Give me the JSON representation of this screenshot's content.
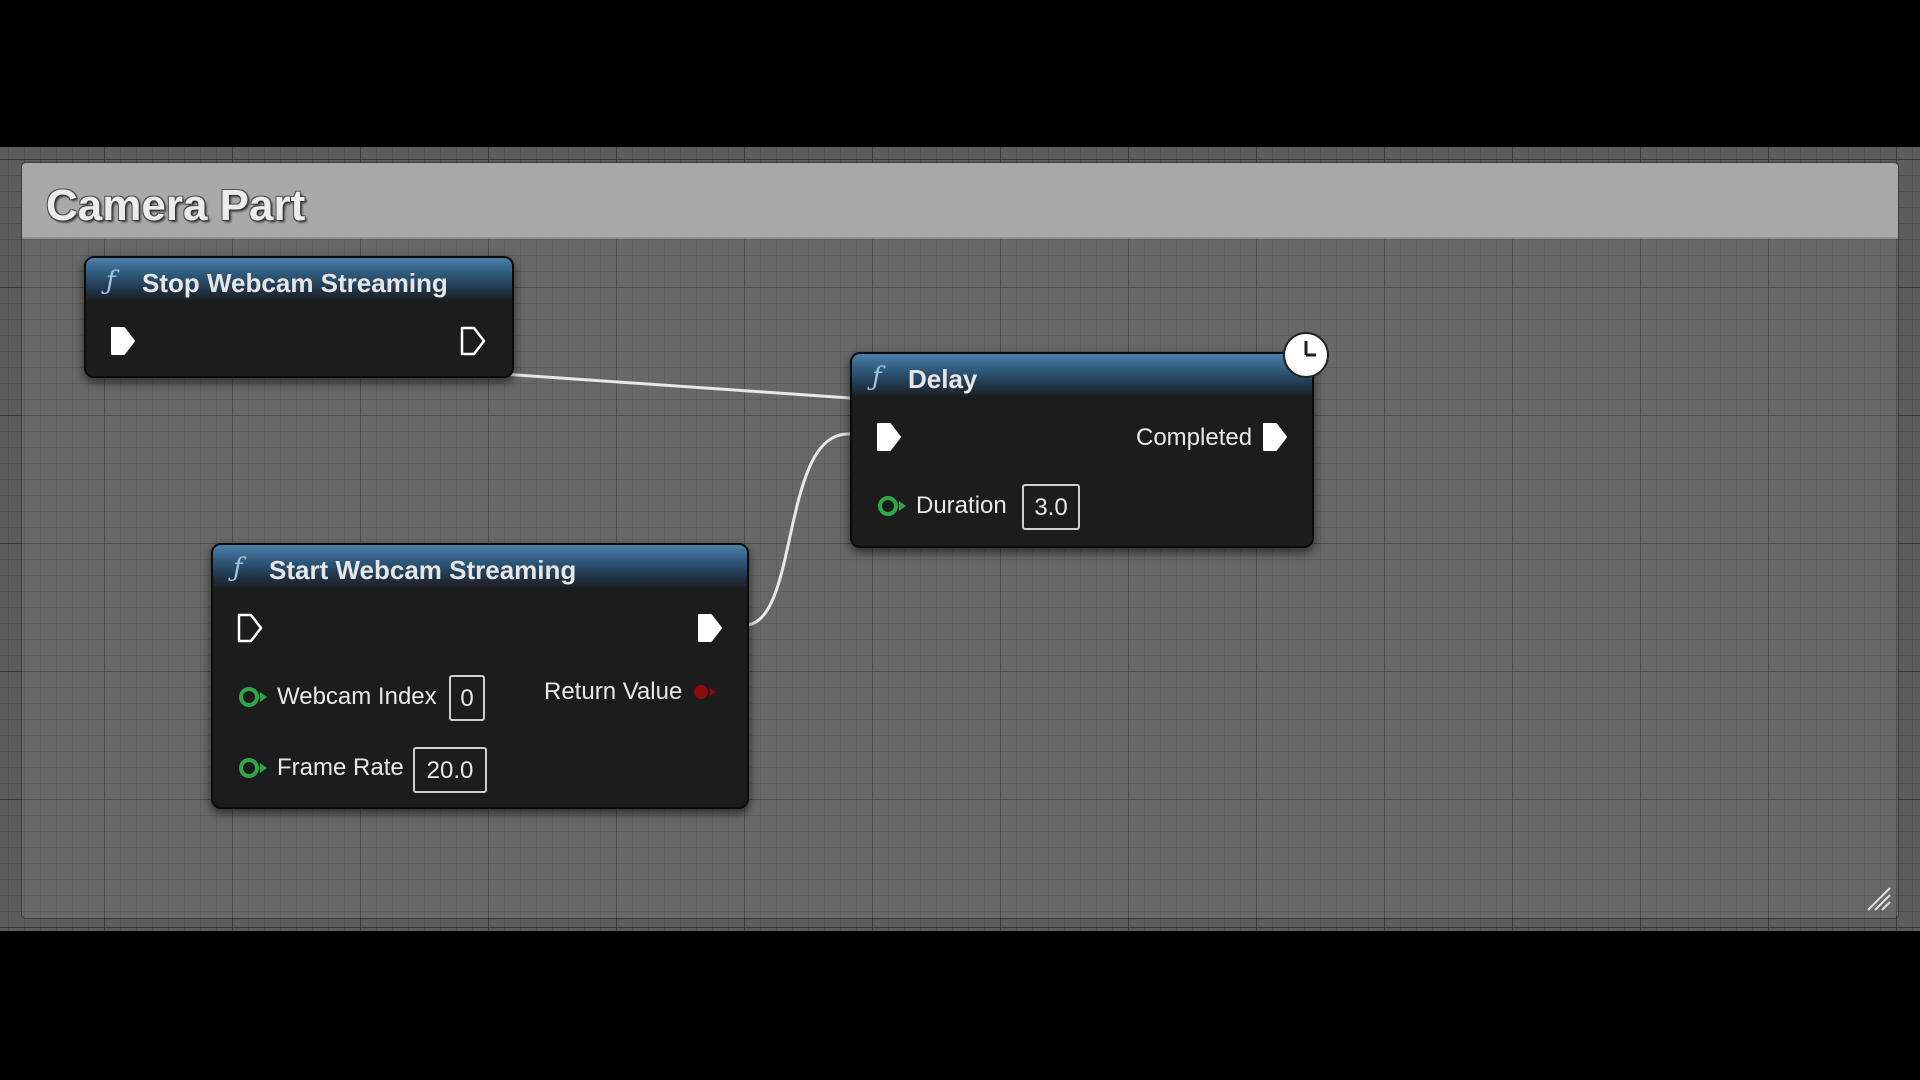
{
  "comment": {
    "title": "Camera Part"
  },
  "nodes": {
    "stop_webcam": {
      "title": "Stop Webcam Streaming",
      "icon": "function-icon"
    },
    "delay": {
      "title": "Delay",
      "icon": "function-icon",
      "latent_icon": "clock-icon",
      "completed_label": "Completed",
      "duration_label": "Duration",
      "duration_value": "3.0"
    },
    "start_webcam": {
      "title": "Start Webcam Streaming",
      "icon": "function-icon",
      "webcam_index_label": "Webcam Index",
      "webcam_index_value": "0",
      "frame_rate_label": "Frame Rate",
      "frame_rate_value": "20.0",
      "return_value_label": "Return Value"
    }
  },
  "colors": {
    "canvas_bg": "#5c5c5c",
    "comment_header": "#a9a9a9",
    "node_header": "#2d5576",
    "float_pin": "#2aa84a",
    "bool_pin": "#8a0d0d",
    "wire": "#e8e8e8"
  }
}
